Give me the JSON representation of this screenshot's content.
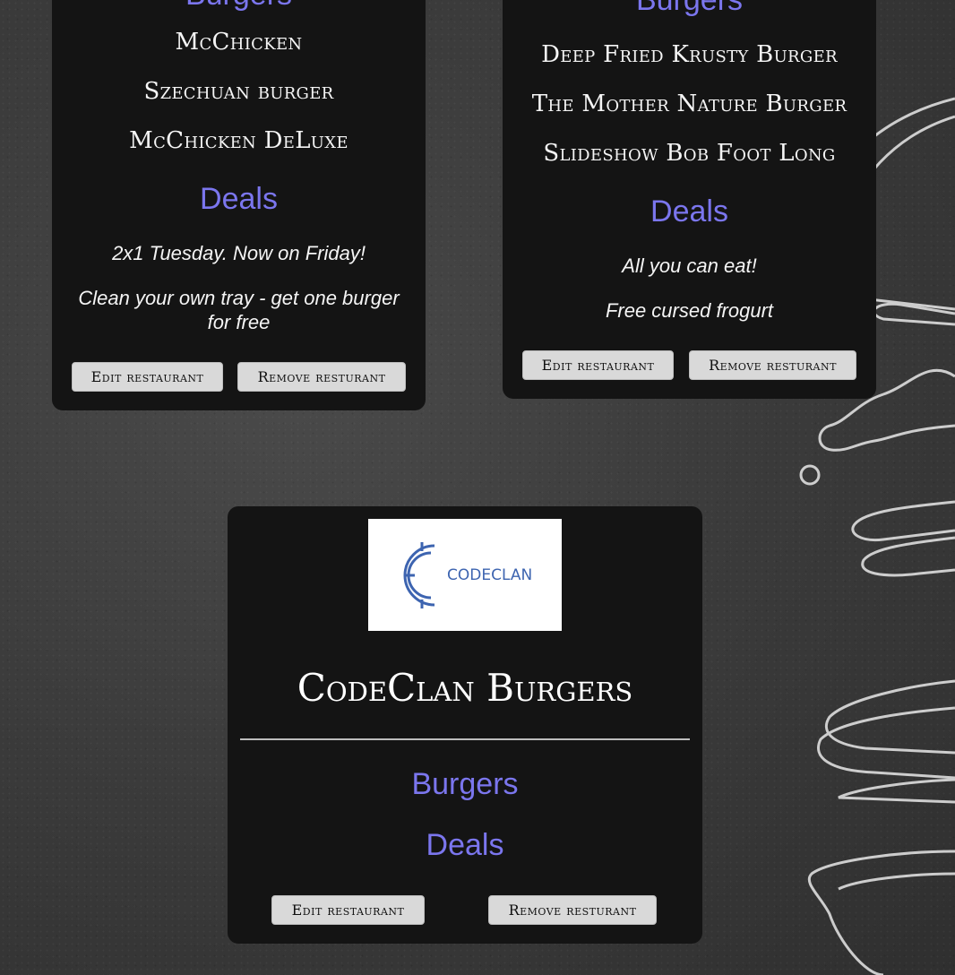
{
  "card_left": {
    "title_partial": "Burgers",
    "burgers": [
      "McChicken",
      "Szechuan burger",
      "McChicken DeLuxe"
    ],
    "deals_title": "Deals",
    "deals": [
      "2x1 Tuesday. Now on Friday!",
      "Clean your own tray - get one burger for free"
    ],
    "edit_label": "Edit restaurant",
    "remove_label": "Remove resturant"
  },
  "card_right": {
    "title_partial": "Burgers",
    "burgers": [
      "Deep Fried Krusty Burger",
      "The Mother Nature Burger",
      "Slideshow Bob Foot Long"
    ],
    "deals_title": "Deals",
    "deals": [
      "All you can eat!",
      "Free cursed frogurt"
    ],
    "edit_label": "Edit restaurant",
    "remove_label": "Remove resturant"
  },
  "card_bottom": {
    "logo_text": "CODECLAN",
    "name": "CodeClan Burgers",
    "burgers_title": "Burgers",
    "deals_title": "Deals",
    "edit_label": "Edit restaurant",
    "remove_label": "Remove resturant"
  },
  "colors": {
    "accent": "#7b76ee",
    "card_bg": "#141414",
    "button_bg": "#d9d9d9"
  }
}
